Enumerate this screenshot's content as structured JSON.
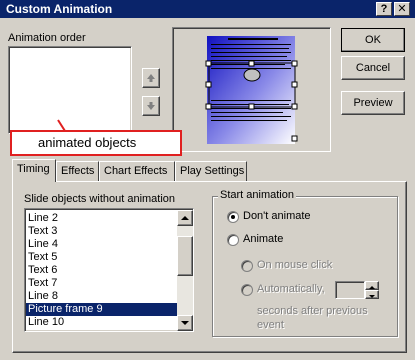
{
  "window": {
    "title": "Custom Animation",
    "help_glyph": "?",
    "close_glyph": "✕"
  },
  "animation_order": {
    "label": "Animation order"
  },
  "buttons": {
    "ok": "OK",
    "cancel": "Cancel",
    "preview": "Preview"
  },
  "callout": {
    "text": "animated objects"
  },
  "tabs": [
    {
      "label": "Timing",
      "active": true
    },
    {
      "label": "Effects"
    },
    {
      "label": "Chart Effects"
    },
    {
      "label": "Play Settings"
    }
  ],
  "timing": {
    "list_label": "Slide objects without animation",
    "items": [
      "Line 2",
      "Text 3",
      "Line 4",
      "Text 5",
      "Text 6",
      "Text 7",
      "Line 8",
      "Picture frame 9",
      "Line 10"
    ],
    "selected_index": 7,
    "start_group": {
      "title": "Start animation",
      "dont_animate": "Don't animate",
      "animate": "Animate",
      "on_mouse_click": "On mouse click",
      "automatically": "Automatically,",
      "seconds_after": "seconds after previous",
      "event": "event"
    }
  },
  "colors": {
    "titlebar": "#0a246a",
    "face": "#d4d0c8",
    "callout_border": "#e02020"
  }
}
